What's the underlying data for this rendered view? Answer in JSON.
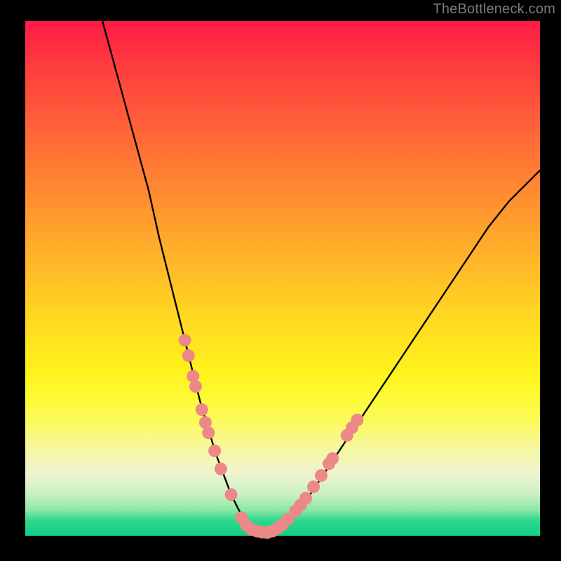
{
  "watermark": "TheBottleneck.com",
  "chart_data": {
    "type": "line",
    "title": "",
    "xlabel": "",
    "ylabel": "",
    "xlim": [
      0,
      100
    ],
    "ylim": [
      0,
      100
    ],
    "grid": false,
    "series": [
      {
        "name": "bottleneck-curve",
        "color": "#000000",
        "x": [
          15,
          18,
          21,
          24,
          26,
          28,
          29.5,
          31,
          32.5,
          34,
          35.5,
          37,
          38.5,
          40,
          41.5,
          43,
          44.5,
          47,
          50,
          54,
          58,
          62,
          66,
          70,
          74,
          78,
          82,
          86,
          90,
          94,
          98,
          100
        ],
        "y": [
          100,
          89,
          78,
          67,
          58,
          50,
          44,
          38,
          32,
          26,
          21,
          16,
          12,
          8,
          5,
          2.5,
          1,
          0.5,
          2,
          6,
          12,
          18,
          24,
          30,
          36,
          42,
          48,
          54,
          60,
          65,
          69,
          71
        ]
      }
    ],
    "markers": {
      "name": "emphasis-dots",
      "color": "#ec8887",
      "radius_px": 9,
      "points": [
        {
          "x": 31.0,
          "y": 38.0
        },
        {
          "x": 31.7,
          "y": 35.0
        },
        {
          "x": 32.6,
          "y": 31.0
        },
        {
          "x": 33.1,
          "y": 29.0
        },
        {
          "x": 34.3,
          "y": 24.5
        },
        {
          "x": 35.0,
          "y": 22.0
        },
        {
          "x": 35.6,
          "y": 20.0
        },
        {
          "x": 36.8,
          "y": 16.5
        },
        {
          "x": 38.0,
          "y": 13.0
        },
        {
          "x": 40.0,
          "y": 8.0
        },
        {
          "x": 42.0,
          "y": 3.5
        },
        {
          "x": 43.0,
          "y": 2.0
        },
        {
          "x": 44.0,
          "y": 1.2
        },
        {
          "x": 45.0,
          "y": 0.9
        },
        {
          "x": 46.0,
          "y": 0.7
        },
        {
          "x": 47.0,
          "y": 0.6
        },
        {
          "x": 48.0,
          "y": 0.9
        },
        {
          "x": 49.0,
          "y": 1.5
        },
        {
          "x": 50.0,
          "y": 2.2
        },
        {
          "x": 51.0,
          "y": 3.2
        },
        {
          "x": 52.5,
          "y": 4.8
        },
        {
          "x": 53.5,
          "y": 6.0
        },
        {
          "x": 54.5,
          "y": 7.3
        },
        {
          "x": 56.0,
          "y": 9.5
        },
        {
          "x": 57.5,
          "y": 11.7
        },
        {
          "x": 59.0,
          "y": 14.0
        },
        {
          "x": 59.7,
          "y": 15.0
        },
        {
          "x": 62.5,
          "y": 19.5
        },
        {
          "x": 63.5,
          "y": 21.0
        },
        {
          "x": 64.5,
          "y": 22.5
        }
      ]
    }
  }
}
